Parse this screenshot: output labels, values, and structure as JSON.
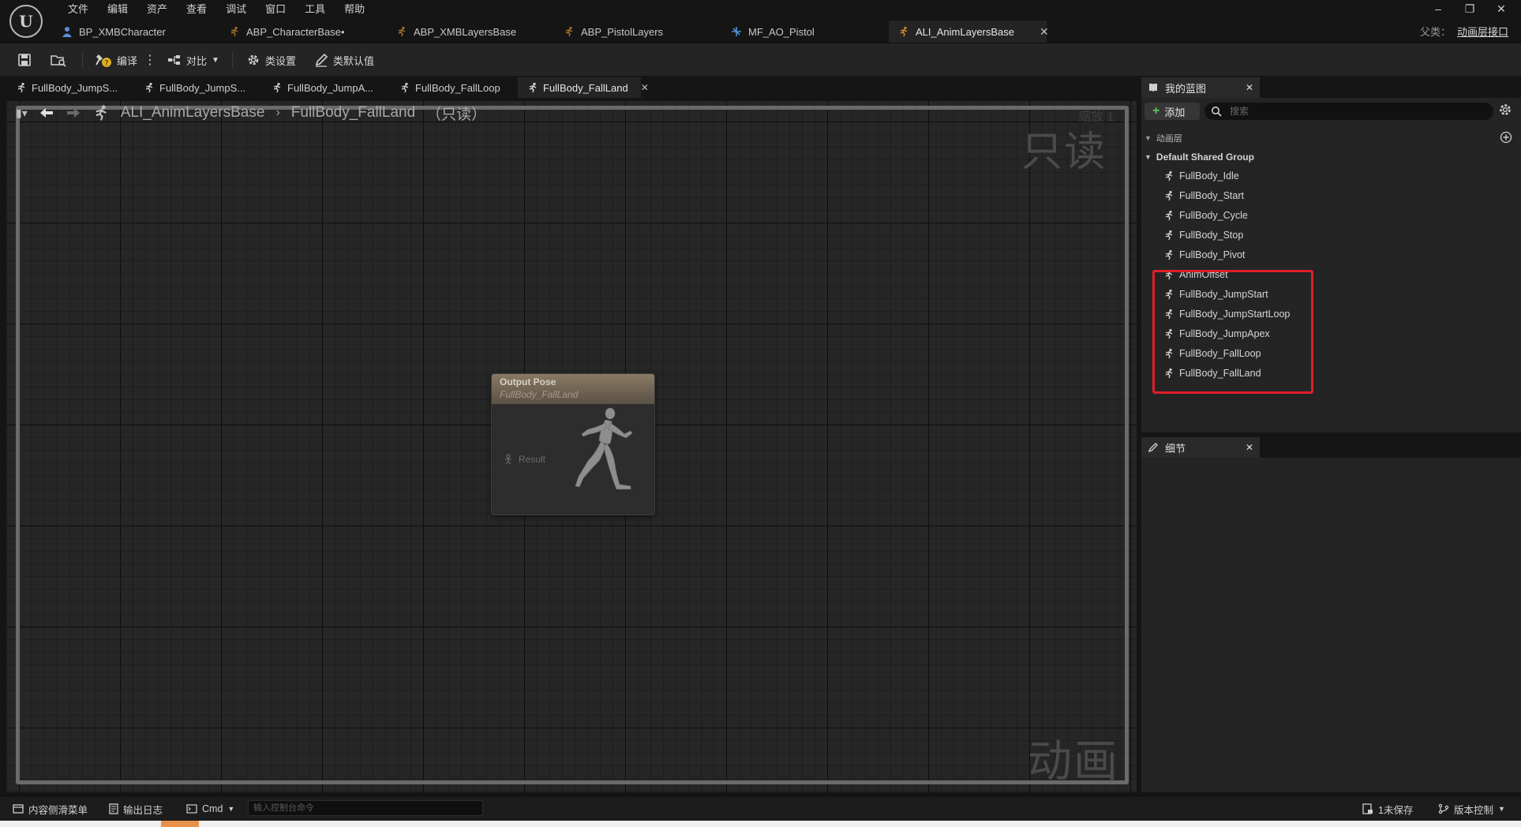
{
  "menubar": [
    "文件",
    "编辑",
    "资产",
    "查看",
    "调试",
    "窗口",
    "工具",
    "帮助"
  ],
  "doc_tabs": [
    {
      "label": "BP_XMBCharacter",
      "icon": "blueprint-person-icon"
    },
    {
      "label": "ABP_CharacterBase•",
      "icon": "anim-blueprint-icon"
    },
    {
      "label": "ABP_XMBLayersBase",
      "icon": "anim-blueprint-icon"
    },
    {
      "label": "ABP_PistolLayers",
      "icon": "anim-blueprint-icon"
    },
    {
      "label": "MF_AO_Pistol",
      "icon": "material-function-icon"
    },
    {
      "label": "ALI_AnimLayersBase",
      "icon": "anim-layer-interface-icon",
      "active": true
    }
  ],
  "window_controls": {
    "minimize": "–",
    "restore": "❐",
    "close": "✕"
  },
  "parent": {
    "label": "父类：",
    "value": "动画层接口"
  },
  "toolbar": {
    "compile": "编译",
    "diff": "对比",
    "class_settings": "类设置",
    "class_defaults": "类默认值"
  },
  "graph_tabs": [
    {
      "label": "FullBody_JumpS..."
    },
    {
      "label": "FullBody_JumpS..."
    },
    {
      "label": "FullBody_JumpA..."
    },
    {
      "label": "FullBody_FallLoop"
    },
    {
      "label": "FullBody_FallLand",
      "active": true
    }
  ],
  "breadcrumb": {
    "root": "ALI_AnimLayersBase",
    "current": "FullBody_FallLand",
    "suffix": "（只读）"
  },
  "zoom_label": "缩放 1",
  "watermarks": {
    "readonly": "只读",
    "type": "动画"
  },
  "output_node": {
    "title": "Output Pose",
    "subtitle": "FullBody_FallLand",
    "pin": "Result"
  },
  "my_blueprint": {
    "tab_label": "我的蓝图",
    "add_label": "添加",
    "search_placeholder": "搜索",
    "section": "动画层",
    "group": "Default Shared Group",
    "layers": [
      "FullBody_Idle",
      "FullBody_Start",
      "FullBody_Cycle",
      "FullBody_Stop",
      "FullBody_Pivot",
      "AnimOffset",
      "FullBody_JumpStart",
      "FullBody_JumpStartLoop",
      "FullBody_JumpApex",
      "FullBody_FallLoop",
      "FullBody_FallLand"
    ]
  },
  "details": {
    "tab_label": "细节"
  },
  "statusbar": {
    "content_drawer": "内容侧滑菜单",
    "output_log": "输出日志",
    "cmd": "Cmd",
    "cmd_placeholder": "输入控制台命令",
    "unsaved": "1未保存",
    "source_control": "版本控制"
  },
  "colors": {
    "highlight": "#e01e28",
    "add_plus": "#5ec35e"
  }
}
